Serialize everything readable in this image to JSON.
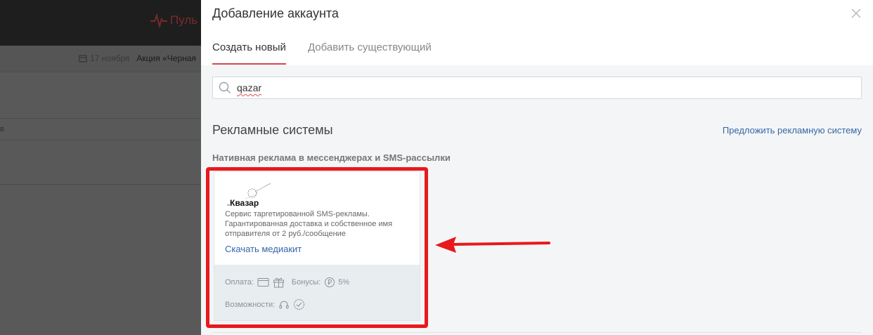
{
  "background_app": {
    "logo_text": "Пуль",
    "date": "17 ноября",
    "promo": "Акция «Черная",
    "row_letter": "в"
  },
  "modal": {
    "title": "Добавление аккаунта",
    "tabs": [
      {
        "label": "Создать новый",
        "active": true
      },
      {
        "label": "Добавить существующий",
        "active": false
      }
    ],
    "search": {
      "value": "qazar"
    },
    "section_title": "Рекламные системы",
    "suggest_link": "Предложить рекламную систему",
    "category_title": "Нативная реклама в мессенджерах и SMS-рассылки",
    "card": {
      "logo_text": "Квазар",
      "description_lines": [
        "Сервис таргетированной SMS-рекламы.",
        "Гарантированная доставка и собственное имя",
        "отправителя от 2 руб./сообщение"
      ],
      "media_link": "Скачать медиакит",
      "payment_label": "Оплата:",
      "bonus_label": "Бонусы:",
      "bonus_value": "5%",
      "features_label": "Возможности:"
    }
  },
  "colors": {
    "accent_red": "#d8434b",
    "link_blue": "#3467a8",
    "highlight_red": "#e8191c"
  }
}
